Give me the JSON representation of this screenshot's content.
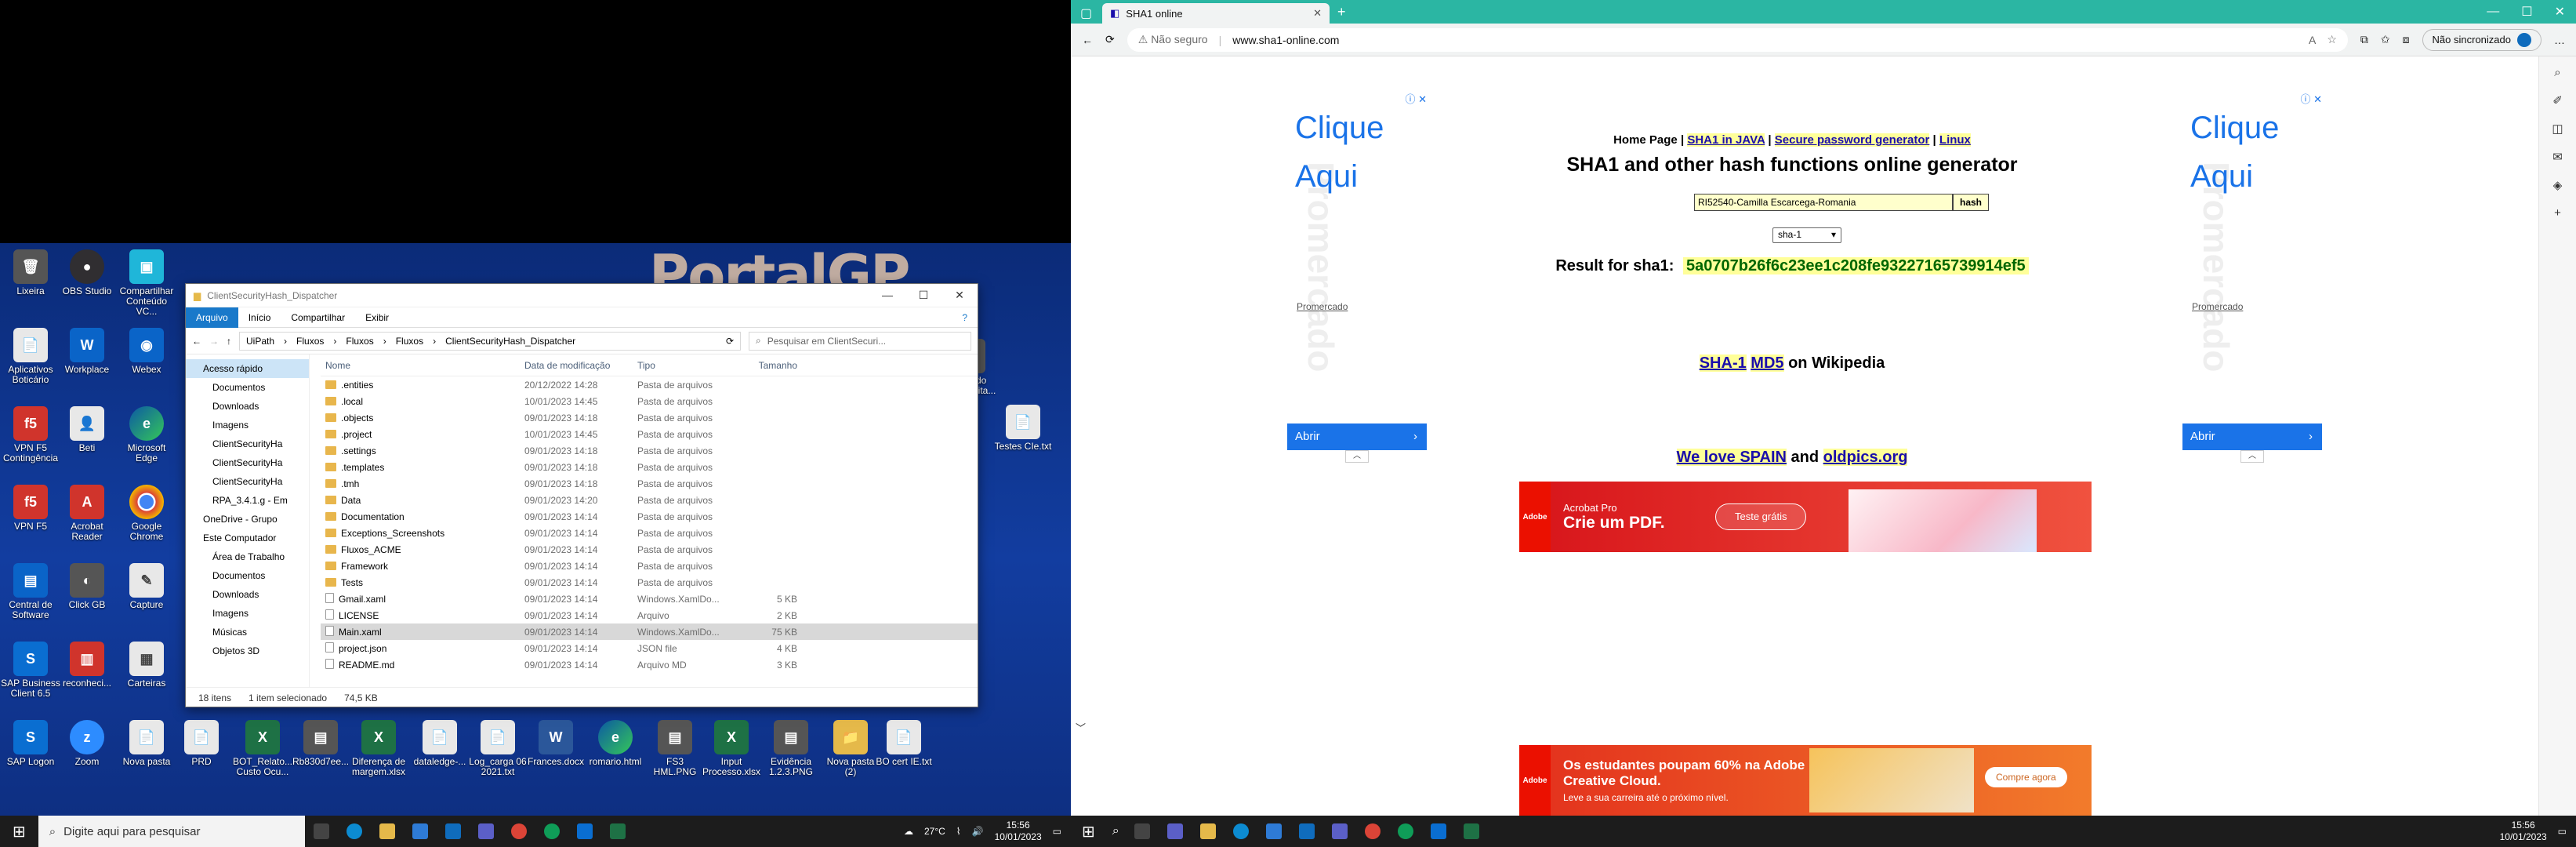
{
  "left_screen": {
    "desktop_text": "PortalGP",
    "desktop_icons": [
      {
        "label": "Lixeira",
        "glyph": "🗑",
        "cls": "pc"
      },
      {
        "label": "OBS Studio",
        "glyph": "●",
        "cls": "obs"
      },
      {
        "label": "Compartilhar Conteúdo VC...",
        "glyph": "▣",
        "cls": "cyan"
      },
      {
        "label": "Aplicativos Boticário",
        "glyph": "📄",
        "cls": "doc"
      },
      {
        "label": "Workplace",
        "glyph": "W",
        "cls": "blue"
      },
      {
        "label": "Webex",
        "glyph": "◉",
        "cls": "blue"
      },
      {
        "label": "VPN F5 Contingência",
        "glyph": "f5",
        "cls": "red"
      },
      {
        "label": "Beti",
        "glyph": "👤",
        "cls": "doc"
      },
      {
        "label": "Microsoft Edge",
        "glyph": "e",
        "cls": "edge"
      },
      {
        "label": "VPN F5",
        "glyph": "f5",
        "cls": "red"
      },
      {
        "label": "Acrobat Reader",
        "glyph": "A",
        "cls": "red"
      },
      {
        "label": "Google Chrome",
        "glyph": "",
        "cls": "chrome"
      },
      {
        "label": "Central de Software",
        "glyph": "▤",
        "cls": "blue"
      },
      {
        "label": "Click GB",
        "glyph": "◐",
        "cls": "pc"
      },
      {
        "label": "Capture",
        "glyph": "✎",
        "cls": "doc"
      },
      {
        "label": "SAP Business Client 6.5",
        "glyph": "S",
        "cls": "sap"
      },
      {
        "label": "reconheci...",
        "glyph": "▥",
        "cls": "red"
      },
      {
        "label": "Carteiras",
        "glyph": "▦",
        "cls": "doc"
      },
      {
        "label": "SAP Logon",
        "glyph": "S",
        "cls": "sap"
      },
      {
        "label": "Zoom",
        "glyph": "z",
        "cls": "zoom"
      },
      {
        "label": "Nova pasta",
        "glyph": "📄",
        "cls": "doc"
      },
      {
        "label": "PRD",
        "glyph": "📄",
        "cls": "doc"
      },
      {
        "label": "BOT_Relato... Custo Ocu...",
        "glyph": "X",
        "cls": "xl"
      },
      {
        "label": "Rb830d7ee...",
        "glyph": "▤",
        "cls": "pc"
      },
      {
        "label": "Diferença de margem.xlsx",
        "glyph": "X",
        "cls": "xl"
      },
      {
        "label": "dataledge-...",
        "glyph": "📄",
        "cls": "doc"
      },
      {
        "label": "Log_carga 06 2021.txt",
        "glyph": "📄",
        "cls": "doc"
      },
      {
        "label": "Frances.docx",
        "glyph": "W",
        "cls": "wd"
      },
      {
        "label": "romario.html",
        "glyph": "e",
        "cls": "edge"
      },
      {
        "label": "FS3 HML.PNG",
        "glyph": "▤",
        "cls": "pc"
      },
      {
        "label": "Input Processo.xlsx",
        "glyph": "X",
        "cls": "xl"
      },
      {
        "label": "Evidência 1.2.3.PNG",
        "glyph": "▤",
        "cls": "pc"
      },
      {
        "label": "Nova pasta (2)",
        "glyph": "📁",
        "cls": "fold"
      },
      {
        "label": "BO cert IE.txt",
        "glyph": "📄",
        "cls": "doc"
      },
      {
        "label": "Mapa do Ciclo_Edita...",
        "glyph": "▤",
        "cls": "pc"
      },
      {
        "label": "Testes CIe.txt",
        "glyph": "📄",
        "cls": "doc"
      }
    ],
    "explorer": {
      "title": "ClientSecurityHash_Dispatcher",
      "ribbon_tabs": [
        "Arquivo",
        "Início",
        "Compartilhar",
        "Exibir"
      ],
      "breadcrumb": [
        "UiPath",
        "Fluxos",
        "Fluxos",
        "Fluxos",
        "ClientSecurityHash_Dispatcher"
      ],
      "search_placeholder": "Pesquisar em ClientSecuri...",
      "nav": [
        {
          "label": "Acesso rápido",
          "cls": "sel"
        },
        {
          "label": "Documentos",
          "cls": "l2"
        },
        {
          "label": "Downloads",
          "cls": "l2"
        },
        {
          "label": "Imagens",
          "cls": "l2"
        },
        {
          "label": "ClientSecurityHa",
          "cls": "l2"
        },
        {
          "label": "ClientSecurityHa",
          "cls": "l2"
        },
        {
          "label": "ClientSecurityHa",
          "cls": "l2"
        },
        {
          "label": "RPA_3.4.1.g - Em",
          "cls": "l2"
        },
        {
          "label": "OneDrive - Grupo",
          "cls": ""
        },
        {
          "label": "Este Computador",
          "cls": ""
        },
        {
          "label": "Área de Trabalho",
          "cls": "l2"
        },
        {
          "label": "Documentos",
          "cls": "l2"
        },
        {
          "label": "Downloads",
          "cls": "l2"
        },
        {
          "label": "Imagens",
          "cls": "l2"
        },
        {
          "label": "Músicas",
          "cls": "l2"
        },
        {
          "label": "Objetos 3D",
          "cls": "l2"
        }
      ],
      "columns": [
        "Nome",
        "Data de modificação",
        "Tipo",
        "Tamanho"
      ],
      "rows": [
        {
          "name": ".entities",
          "date": "20/12/2022 14:28",
          "type": "Pasta de arquivos",
          "size": "",
          "folder": true
        },
        {
          "name": ".local",
          "date": "10/01/2023 14:45",
          "type": "Pasta de arquivos",
          "size": "",
          "folder": true
        },
        {
          "name": ".objects",
          "date": "09/01/2023 14:18",
          "type": "Pasta de arquivos",
          "size": "",
          "folder": true
        },
        {
          "name": ".project",
          "date": "10/01/2023 14:45",
          "type": "Pasta de arquivos",
          "size": "",
          "folder": true
        },
        {
          "name": ".settings",
          "date": "09/01/2023 14:18",
          "type": "Pasta de arquivos",
          "size": "",
          "folder": true
        },
        {
          "name": ".templates",
          "date": "09/01/2023 14:18",
          "type": "Pasta de arquivos",
          "size": "",
          "folder": true
        },
        {
          "name": ".tmh",
          "date": "09/01/2023 14:18",
          "type": "Pasta de arquivos",
          "size": "",
          "folder": true
        },
        {
          "name": "Data",
          "date": "09/01/2023 14:20",
          "type": "Pasta de arquivos",
          "size": "",
          "folder": true
        },
        {
          "name": "Documentation",
          "date": "09/01/2023 14:14",
          "type": "Pasta de arquivos",
          "size": "",
          "folder": true
        },
        {
          "name": "Exceptions_Screenshots",
          "date": "09/01/2023 14:14",
          "type": "Pasta de arquivos",
          "size": "",
          "folder": true
        },
        {
          "name": "Fluxos_ACME",
          "date": "09/01/2023 14:14",
          "type": "Pasta de arquivos",
          "size": "",
          "folder": true
        },
        {
          "name": "Framework",
          "date": "09/01/2023 14:14",
          "type": "Pasta de arquivos",
          "size": "",
          "folder": true
        },
        {
          "name": "Tests",
          "date": "09/01/2023 14:14",
          "type": "Pasta de arquivos",
          "size": "",
          "folder": true
        },
        {
          "name": "Gmail.xaml",
          "date": "09/01/2023 14:14",
          "type": "Windows.XamlDo...",
          "size": "5 KB",
          "folder": false
        },
        {
          "name": "LICENSE",
          "date": "09/01/2023 14:14",
          "type": "Arquivo",
          "size": "2 KB",
          "folder": false
        },
        {
          "name": "Main.xaml",
          "date": "09/01/2023 14:14",
          "type": "Windows.XamlDo...",
          "size": "75 KB",
          "folder": false,
          "selected": true
        },
        {
          "name": "project.json",
          "date": "09/01/2023 14:14",
          "type": "JSON file",
          "size": "4 KB",
          "folder": false
        },
        {
          "name": "README.md",
          "date": "09/01/2023 14:14",
          "type": "Arquivo MD",
          "size": "3 KB",
          "folder": false
        }
      ],
      "status": [
        "18 itens",
        "1 item selecionado",
        "74,5 KB"
      ]
    },
    "taskbar": {
      "search_placeholder": "Digite aqui para pesquisar",
      "weather": "27°C",
      "time": "15:56",
      "date": "10/01/2023"
    }
  },
  "right_screen": {
    "tab_title": "SHA1 online",
    "address": {
      "security": "Não seguro",
      "url": "www.sha1-online.com"
    },
    "sync_label": "Não sincronizado",
    "page": {
      "nav": {
        "home": "Home Page",
        "java": "SHA1 in JAVA",
        "secure": "Secure password generator",
        "linux": "Linux"
      },
      "title": "SHA1 and other hash functions online generator",
      "input_value": "RI52540-Camilla Escarcega-Romania",
      "hash_button": "hash",
      "algorithm": "sha-1",
      "result_label": "Result for sha1:",
      "result_value": "5a0707b26f6c23ee1c208fe93227165739914ef5",
      "wiki": {
        "sha1": "SHA-1",
        "md5": "MD5",
        "rest": "on Wikipedia"
      },
      "spain": {
        "a": "We love SPAIN",
        "and": "and",
        "b": "oldpics.org"
      }
    },
    "side_ads": {
      "headline": "Clique Aqui",
      "watermark": "Promercado",
      "brand": "Promercado",
      "cta": "Abrir"
    },
    "banner_top": {
      "logo": "Adobe",
      "sub": "Acrobat Pro",
      "headline": "Crie um PDF.",
      "button": "Teste grátis"
    },
    "banner_bottom": {
      "logo": "Adobe",
      "headline": "Os estudantes poupam 60% na Adobe Creative Cloud.",
      "sub": "Leve a sua carreira até o próximo nível.",
      "button": "Compre agora"
    },
    "taskbar": {
      "time": "15:56",
      "date": "10/01/2023"
    }
  }
}
